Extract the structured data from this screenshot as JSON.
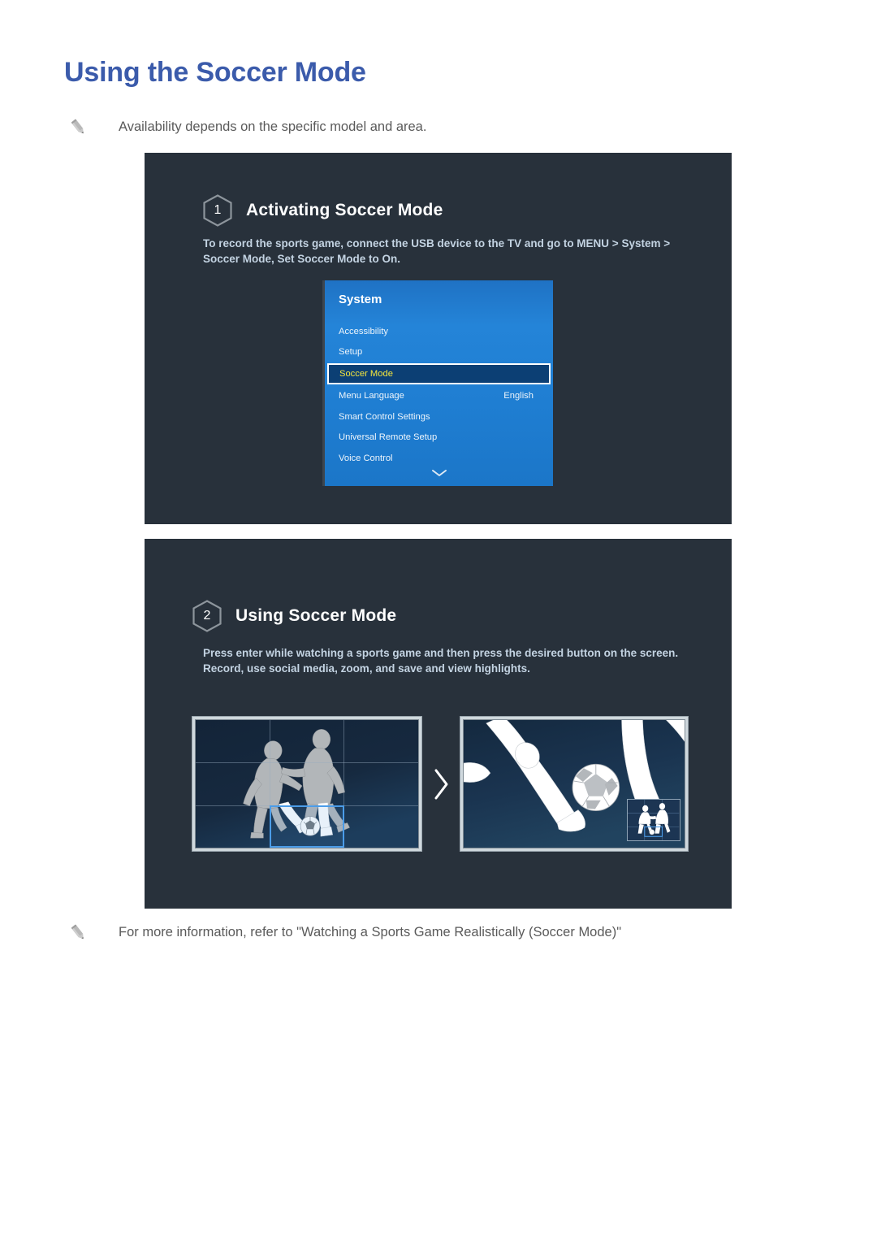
{
  "page": {
    "title": "Using the Soccer Mode",
    "accent_color": "#3b5bab",
    "background_color": "#ffffff"
  },
  "notes": {
    "top": {
      "icon": "pencil-icon",
      "text": "Availability depends on the specific model and area."
    },
    "bottom": {
      "icon": "pencil-icon",
      "text": "For more information, refer to \"Watching a Sports Game Realistically (Soccer Mode)\""
    }
  },
  "steps": [
    {
      "number": "1",
      "title": "Activating Soccer Mode",
      "description": "To record the sports game, connect the USB device to the TV and go to MENU > System > Soccer Mode, Set Soccer Mode to On.",
      "panel_color": "#28313b"
    },
    {
      "number": "2",
      "title": "Using Soccer Mode",
      "description": "Press enter while watching a sports game and then press the desired button on the screen. Record, use social media, zoom, and save and view highlights.",
      "panel_color": "#28313b"
    }
  ],
  "tv_menu": {
    "title": "System",
    "highlight_color": "#f5e63c",
    "selected_row_background": "#0c3f74",
    "menu_background": "#1f7ed2",
    "items": [
      {
        "label": "Accessibility",
        "value": "",
        "selected": false
      },
      {
        "label": "Setup",
        "value": "",
        "selected": false
      },
      {
        "label": "Soccer Mode",
        "value": "",
        "selected": true
      },
      {
        "label": "Menu Language",
        "value": "English",
        "selected": false
      },
      {
        "label": "Smart Control Settings",
        "value": "",
        "selected": false
      },
      {
        "label": "Universal Remote Setup",
        "value": "",
        "selected": false
      },
      {
        "label": "Voice Control",
        "value": "",
        "selected": false
      }
    ],
    "scroll_indicator": "chevron-down-icon"
  },
  "soccer_demo": {
    "left_screen": {
      "name": "full-view-screen",
      "description": "Two soccer players contesting the ball with a 3x3 grid overlay",
      "grid": {
        "rows": 3,
        "columns": 3
      },
      "selection_box": {
        "cell": "bottom-center",
        "color": "#4b9ce8"
      }
    },
    "transition_icon": "chevron-right-icon",
    "right_screen": {
      "name": "zoomed-view-screen",
      "description": "Zoomed view of legs and soccer ball with picture-in-picture thumbnail",
      "pip": {
        "position": "bottom-right",
        "description": "Miniature full view with selection box"
      }
    }
  }
}
